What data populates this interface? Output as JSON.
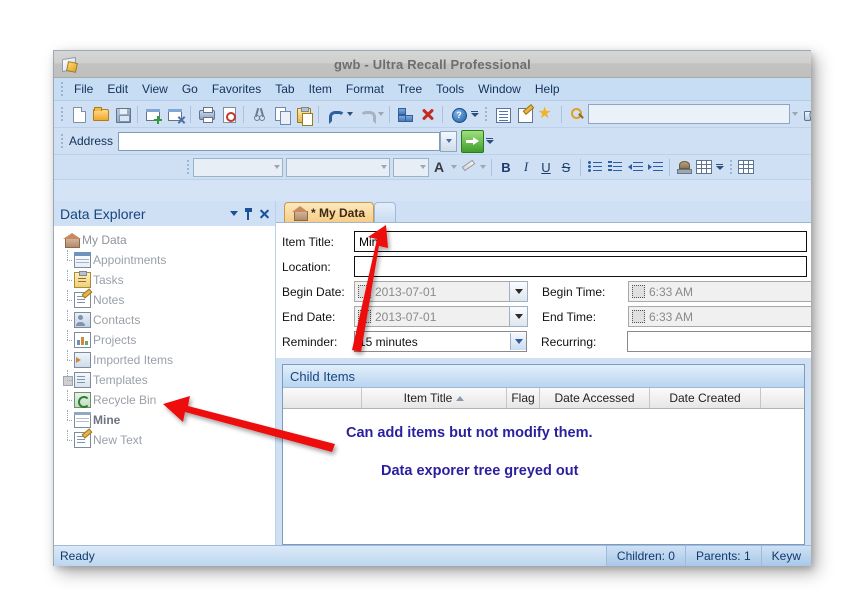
{
  "window": {
    "title": "gwb  -  Ultra Recall Professional"
  },
  "menubar": {
    "items": [
      "File",
      "Edit",
      "View",
      "Go",
      "Favorites",
      "Tab",
      "Item",
      "Format",
      "Tree",
      "Tools",
      "Window",
      "Help"
    ]
  },
  "toolbar": {
    "icons": [
      "new-document-icon",
      "open-folder-icon",
      "save-icon",
      "new-window-icon",
      "close-window-icon",
      "print-icon",
      "print-preview-icon",
      "cut-icon",
      "copy-icon",
      "paste-icon",
      "undo-icon",
      "redo-icon",
      "link-items-icon",
      "delete-icon",
      "help-icon"
    ],
    "search_placeholder": "",
    "search_value": ""
  },
  "address": {
    "label": "Address",
    "value": "",
    "placeholder": "",
    "go_label": "Go"
  },
  "format_toolbar": {
    "style_value": "",
    "font_value": "",
    "size_value": "",
    "bold": "B",
    "italic": "I",
    "underline": "U",
    "strike": "S"
  },
  "sidebar": {
    "title": "Data Explorer",
    "items": [
      {
        "label": "My Data",
        "icon": "home-icon",
        "level": 0,
        "bold": false
      },
      {
        "label": "Appointments",
        "icon": "calendar-icon",
        "level": 1,
        "bold": false
      },
      {
        "label": "Tasks",
        "icon": "clipboard-icon",
        "level": 1,
        "bold": false
      },
      {
        "label": "Notes",
        "icon": "note-icon",
        "level": 1,
        "bold": false
      },
      {
        "label": "Contacts",
        "icon": "contact-icon",
        "level": 1,
        "bold": false
      },
      {
        "label": "Projects",
        "icon": "projects-icon",
        "level": 1,
        "bold": false
      },
      {
        "label": "Imported Items",
        "icon": "import-icon",
        "level": 1,
        "bold": false
      },
      {
        "label": "Templates",
        "icon": "template-icon",
        "level": 1,
        "bold": false,
        "expander": true
      },
      {
        "label": "Recycle Bin",
        "icon": "recycle-bin-icon",
        "level": 1,
        "bold": false
      },
      {
        "label": "Mine",
        "icon": "grid-icon",
        "level": 1,
        "bold": true
      },
      {
        "label": "New Text",
        "icon": "note-icon",
        "level": 1,
        "bold": false
      }
    ]
  },
  "tabs": [
    {
      "label": "* My Data",
      "icon": "home-icon",
      "active": true
    },
    {
      "label": "",
      "icon": "",
      "active": false
    }
  ],
  "form": {
    "item_title_label": "Item Title:",
    "item_title_value": "Mine",
    "location_label": "Location:",
    "location_value": "",
    "begin_date_label": "Begin Date:",
    "begin_date_value": "2013-07-01",
    "begin_time_label": "Begin Time:",
    "begin_time_value": "6:33 AM",
    "end_date_label": "End Date:",
    "end_date_value": "2013-07-01",
    "end_time_label": "End Time:",
    "end_time_value": "6:33 AM",
    "reminder_label": "Reminder:",
    "reminder_value": "15 minutes",
    "recurring_label": "Recurring:",
    "recurring_value": ""
  },
  "child_items": {
    "title": "Child Items",
    "columns": [
      "",
      "Item Title",
      "Flag",
      "Date Accessed",
      "Date Created",
      ""
    ],
    "sort_column": "Item Title",
    "sort_direction": "ascending",
    "rows": []
  },
  "statusbar": {
    "ready": "Ready",
    "children": "Children: 0",
    "parents": "Parents: 1",
    "keywords": "Keyw"
  },
  "annotations": [
    {
      "text": "Can add items but not modify them."
    },
    {
      "text": "Data exporer tree greyed out"
    }
  ],
  "colors": {
    "annotation": "#2a1f9e",
    "arrow": "#ee1111",
    "accent": "#17457f",
    "tab_active": "#f7cd86"
  }
}
